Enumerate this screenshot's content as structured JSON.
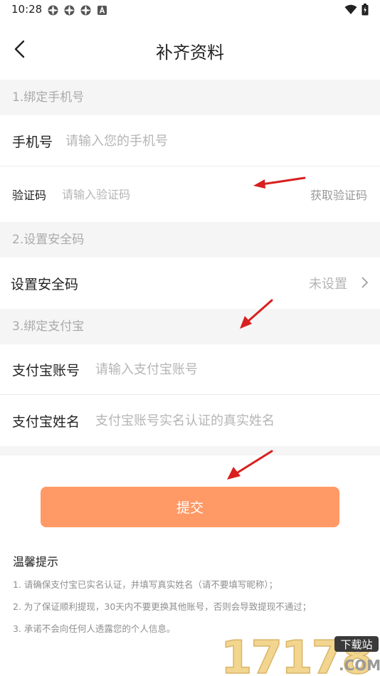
{
  "status_bar": {
    "time": "10:28"
  },
  "header": {
    "title": "补齐资料"
  },
  "sections": {
    "phone": "1.绑定手机号",
    "security": "2.设置安全码",
    "alipay": "3.绑定支付宝"
  },
  "phone_row": {
    "label": "手机号",
    "placeholder": "请输入您的手机号"
  },
  "code_row": {
    "label": "验证码",
    "placeholder": "请输入验证码",
    "action": "获取验证码"
  },
  "security_row": {
    "label": "设置安全码",
    "status": "未设置"
  },
  "alipay_account_row": {
    "label": "支付宝账号",
    "placeholder": "请输入支付宝账号"
  },
  "alipay_name_row": {
    "label": "支付宝姓名",
    "placeholder": "支付宝账号实名认证的真实姓名"
  },
  "submit_label": "提交",
  "tips": {
    "title": "温馨提示",
    "items": [
      "1. 请确保支付宝已实名认证，并填写真实姓名（请不要填写昵称）；",
      "2. 为了保证顺利提现，30天内不要更换其他账号，否则会导致提现不通过；",
      "3. 承诺不会向任何人透露您的个人信息。"
    ]
  },
  "watermark": {
    "number": "17178",
    "badge": "下载站",
    "suffix": ".COM"
  },
  "colors": {
    "accent": "#ff9966",
    "section_bg": "#f5f5f5",
    "arrow": "#d91f1f"
  }
}
